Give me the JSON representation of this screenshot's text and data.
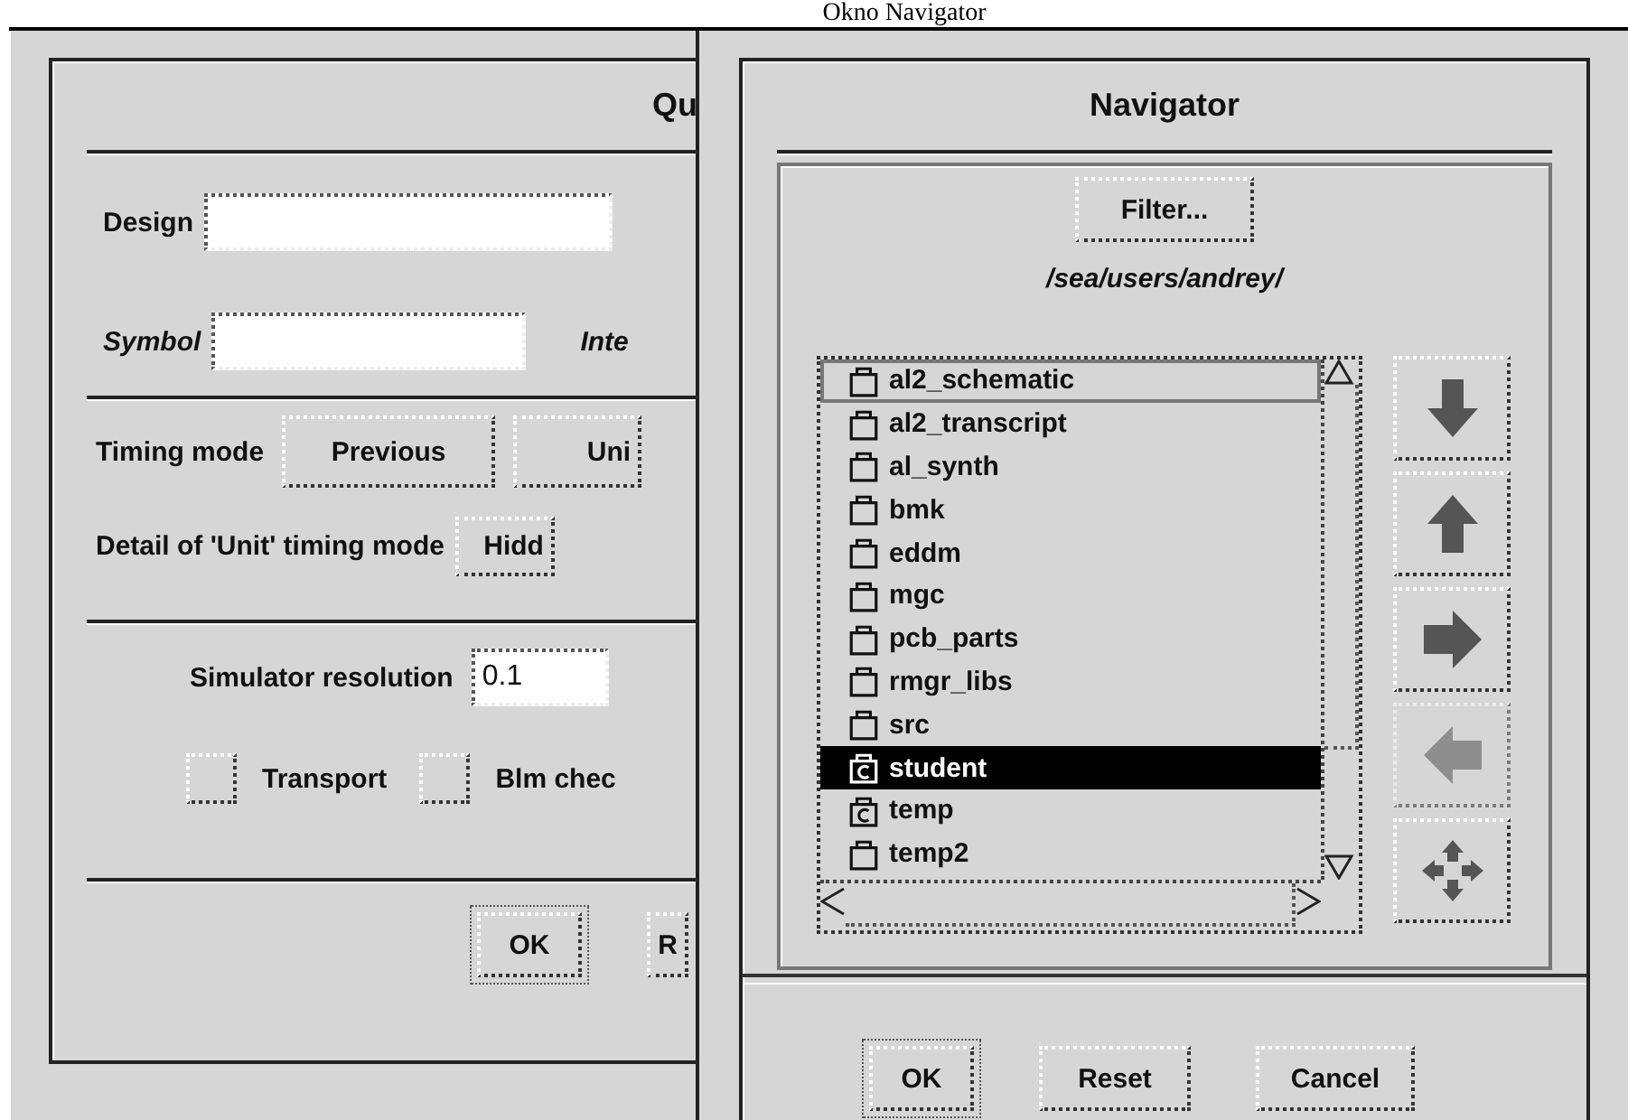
{
  "screen_title": "Okno Navigator",
  "query_dialog": {
    "title": "Qu",
    "design": {
      "label": "Design"
    },
    "symbol": {
      "label": "Symbol"
    },
    "symbol_side_label": "Inte",
    "timing": {
      "label": "Timing mode",
      "buttons": [
        "Previous",
        "Uni"
      ]
    },
    "detail": {
      "label": "Detail of 'Unit' timing mode",
      "button": "Hidd"
    },
    "resolution": {
      "label": "Simulator resolution",
      "value": "0.1"
    },
    "checkboxes": [
      {
        "label": "Transport",
        "checked": false
      },
      {
        "label": "Blm chec",
        "checked": false
      }
    ],
    "buttons": [
      {
        "label": "OK",
        "default": true
      },
      {
        "label": "R",
        "default": false
      }
    ]
  },
  "navigator": {
    "title": "Navigator",
    "filter_button": "Filter...",
    "path": "/sea/users/andrey/",
    "items": [
      {
        "name": "al2_schematic",
        "kind": "folder",
        "selected": false,
        "focused": true
      },
      {
        "name": "al2_transcript",
        "kind": "folder",
        "selected": false,
        "focused": false
      },
      {
        "name": "al_synth",
        "kind": "folder",
        "selected": false,
        "focused": false
      },
      {
        "name": "bmk",
        "kind": "folder",
        "selected": false,
        "focused": false
      },
      {
        "name": "eddm",
        "kind": "folder",
        "selected": false,
        "focused": false
      },
      {
        "name": "mgc",
        "kind": "folder",
        "selected": false,
        "focused": false
      },
      {
        "name": "pcb_parts",
        "kind": "folder",
        "selected": false,
        "focused": false
      },
      {
        "name": "rmgr_libs",
        "kind": "folder",
        "selected": false,
        "focused": false
      },
      {
        "name": "src",
        "kind": "folder",
        "selected": false,
        "focused": false
      },
      {
        "name": "student",
        "kind": "component",
        "selected": true,
        "focused": false
      },
      {
        "name": "temp",
        "kind": "component",
        "selected": false,
        "focused": false
      },
      {
        "name": "temp2",
        "kind": "folder",
        "selected": false,
        "focused": false
      }
    ],
    "arrow_buttons": [
      {
        "kind": "down",
        "disabled": false
      },
      {
        "kind": "up",
        "disabled": false
      },
      {
        "kind": "right",
        "disabled": false
      },
      {
        "kind": "left",
        "disabled": true
      },
      {
        "kind": "move",
        "disabled": false
      }
    ],
    "buttons": [
      {
        "label": "OK",
        "default": true
      },
      {
        "label": "Reset",
        "default": false
      },
      {
        "label": "Cancel",
        "default": false
      }
    ]
  }
}
